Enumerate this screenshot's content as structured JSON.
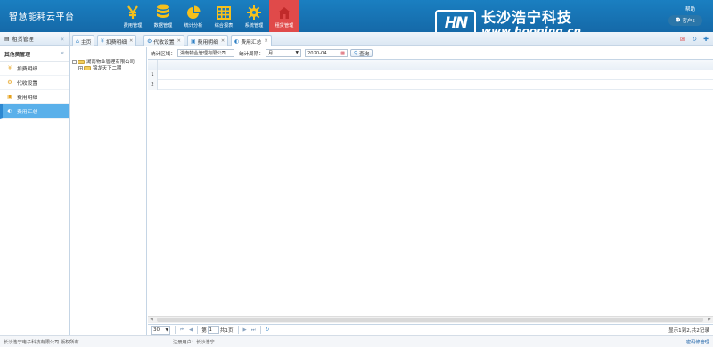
{
  "app": {
    "title": "智慧能耗云平台"
  },
  "nav": [
    {
      "label": "费用管理",
      "icon": "yen-icon"
    },
    {
      "label": "数据管理",
      "icon": "database-icon"
    },
    {
      "label": "统计分析",
      "icon": "pie-chart-icon"
    },
    {
      "label": "综合报表",
      "icon": "table-icon"
    },
    {
      "label": "系统管理",
      "icon": "gear-icon"
    },
    {
      "label": "租赁管理",
      "icon": "house-icon",
      "active": true
    }
  ],
  "logo": {
    "mark": "HN",
    "cn": "长沙浩宁科技",
    "url": "www.hooning.cn"
  },
  "header": {
    "help": "帮助",
    "user": "客户5"
  },
  "sidebar": {
    "title": "租赁管理",
    "group": "其他费管理",
    "items": [
      {
        "label": "扣费明细",
        "icon": "yen-icon"
      },
      {
        "label": "代收设置",
        "icon": "settings-icon"
      },
      {
        "label": "费用明细",
        "icon": "book-icon"
      },
      {
        "label": "费用汇总",
        "icon": "chart-icon",
        "active": true
      }
    ]
  },
  "tabs": [
    {
      "label": "主页",
      "icon": "home-icon"
    },
    {
      "label": "扣费明细",
      "icon": "yen-icon"
    },
    {
      "label": "代收设置",
      "icon": "settings-icon"
    },
    {
      "label": "费用明细",
      "icon": "book-icon"
    },
    {
      "label": "费用汇总",
      "icon": "chart-icon",
      "active": true
    }
  ],
  "tree": {
    "root": "湖南物业管理有限公司",
    "child": "锦龙天下二期"
  },
  "toolbar": {
    "region_label": "统计区域：",
    "region_value": "湖南物业管理有限公司",
    "period_label": "统计周期：",
    "period_value": "月",
    "date_value": "2020-04",
    "search_label": "查询"
  },
  "grid": {
    "rows": [
      "1",
      "2"
    ]
  },
  "pager": {
    "page_size": "30",
    "page_prefix": "第",
    "page_value": "1",
    "page_suffix": "共1页",
    "info": "显示1到2,共2记录"
  },
  "footer": {
    "copyright": "长沙浩宁电子科技有限公司 版权所有",
    "user": "注册用户：长沙浩宁",
    "right": "密码修管理"
  },
  "colors": {
    "header": "#1a7fc1",
    "active_nav": "#e04a4a",
    "active_item": "#5ab0ea"
  }
}
